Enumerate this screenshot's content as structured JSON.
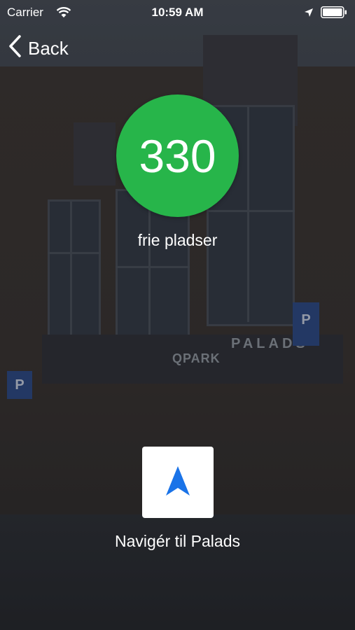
{
  "status_bar": {
    "carrier": "Carrier",
    "time": "10:59 AM",
    "icons": [
      "wifi-icon",
      "location-arrow-icon",
      "battery-icon"
    ]
  },
  "nav": {
    "back_label": "Back"
  },
  "parking": {
    "free_count": "330",
    "free_label": "frie pladser",
    "count_color": "#27b54a"
  },
  "navigate": {
    "label": "Navigér til Palads",
    "icon": "navigation-arrow-icon",
    "icon_color": "#1a73e8"
  },
  "background": {
    "sign_text": "PALADS",
    "brand_logo": "QPARK",
    "parking_sign": "P"
  }
}
